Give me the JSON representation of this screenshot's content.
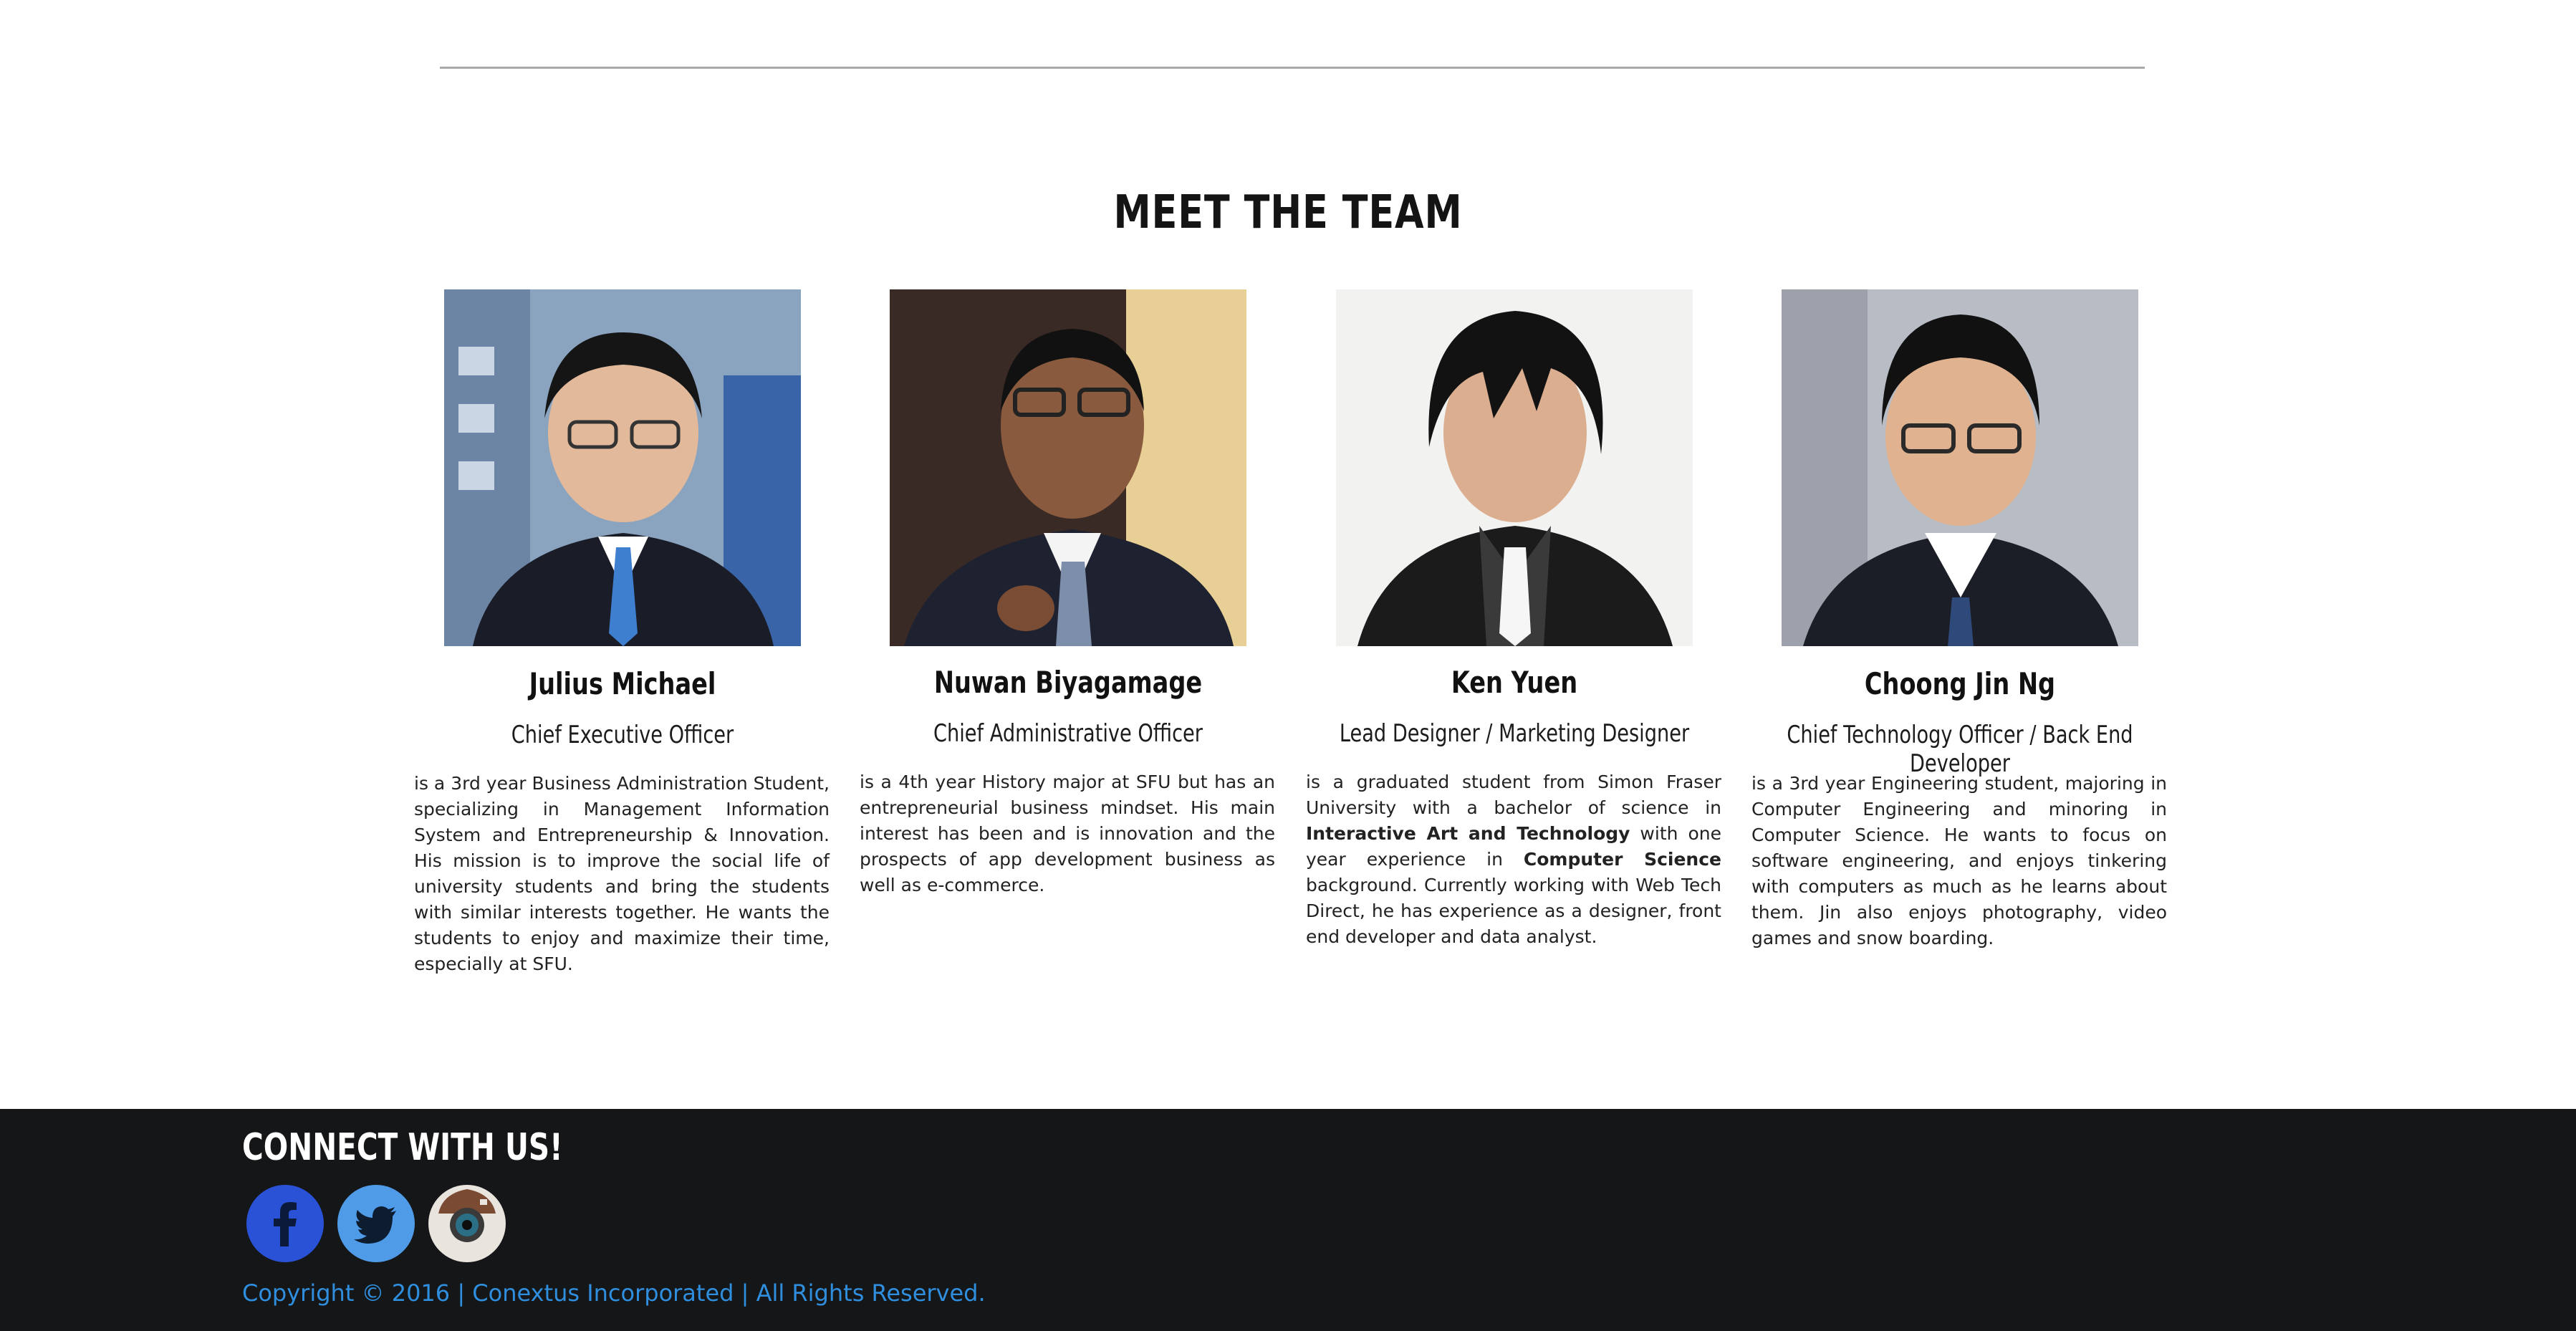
{
  "section": {
    "title": "MEET THE TEAM"
  },
  "team": [
    {
      "name": "Julius Michael",
      "role": "Chief Executive Officer",
      "bio": "is a 3rd year Business Administration Student, specializing in Management Information System and Entrepreneurship & Innovation. His mission is to improve the social life of university students and bring the students with similar interests together. He wants the students to enjoy and maximize their time, especially at SFU."
    },
    {
      "name": "Nuwan Biyagamage",
      "role": "Chief Administrative Officer",
      "bio": "is a 4th year History major at SFU but has an entrepreneurial business mindset. His main interest has been and is innovation and the prospects of app development business as well as e-commerce."
    },
    {
      "name": "Ken Yuen",
      "role": "Lead Designer / Marketing Designer",
      "bio_parts": [
        "is a graduated student from Simon Fraser University with a bachelor of science in ",
        "Interactive Art and Technology",
        " with one year experience in ",
        "Computer Science",
        " background. Currently working with Web Tech Direct, he has experience as a designer, front end developer and data analyst."
      ]
    },
    {
      "name": "Choong Jin Ng",
      "role": "Chief Technology Officer / Back End Developer",
      "bio": "is a 3rd year Engineering student, majoring in Computer Engineering and minoring in Computer Science. He wants to focus on software engineering, and enjoys tinkering with computers as much as he learns about them. Jin also enjoys photography, video games and snow boarding."
    }
  ],
  "footer": {
    "heading": "CONNECT WITH US!",
    "social": [
      {
        "icon": "facebook-icon",
        "glyph": "f",
        "color": "#2a52d6"
      },
      {
        "icon": "twitter-icon",
        "color": "#4f9be8"
      },
      {
        "icon": "instagram-icon",
        "color": "#e9e5de"
      }
    ],
    "copyright": "Copyright © 2016 | Conextus Incorporated | All Rights Reserved."
  },
  "colors": {
    "footer_bg": "#141618",
    "copyright_text": "#2f8fde"
  }
}
